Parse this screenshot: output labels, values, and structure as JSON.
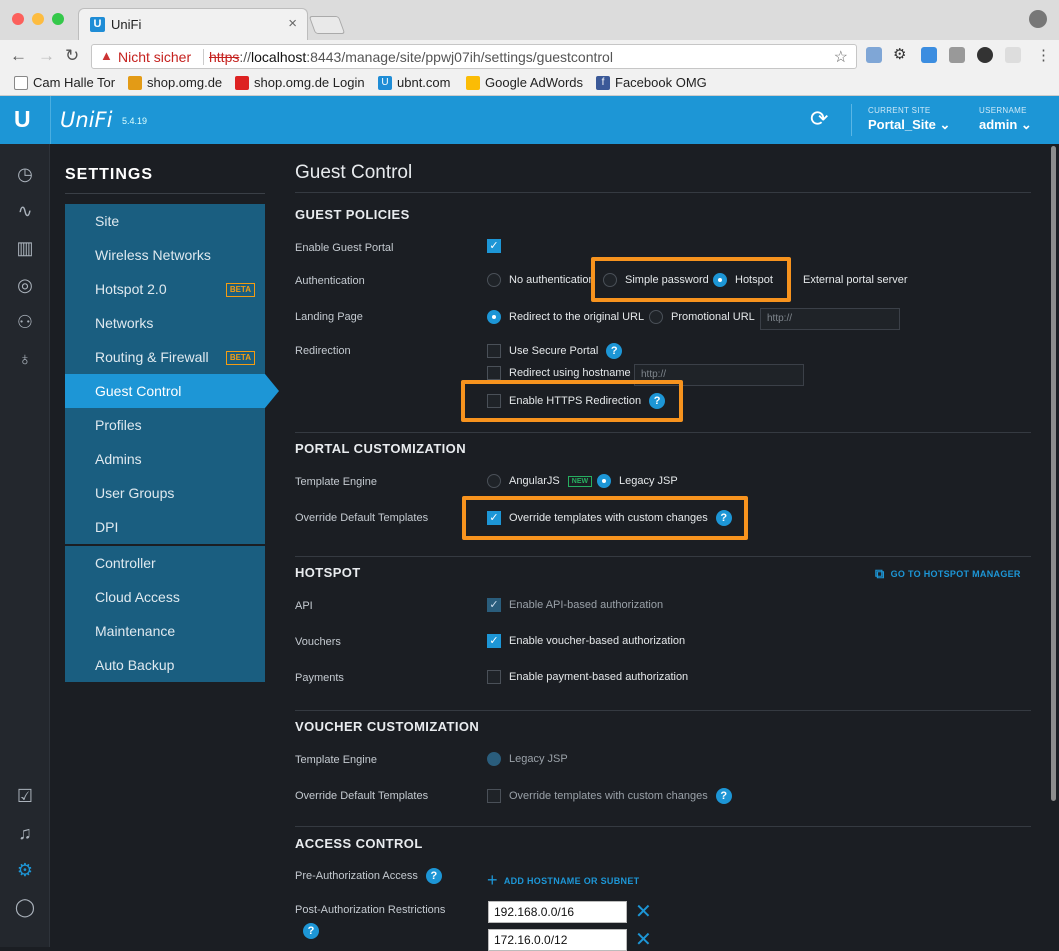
{
  "browser": {
    "tab_title": "UniFi",
    "tab_close": "×",
    "security_label": "Nicht sicher",
    "url_scheme": "https",
    "url_sep": "://",
    "url_host": "localhost",
    "url_rest": ":8443/manage/site/ppwj07ih/settings/guestcontrol",
    "bookmarks": [
      "Cam Halle Tor",
      "shop.omg.de",
      "shop.omg.de Login",
      "ubnt.com",
      "Google AdWords",
      "Facebook OMG"
    ]
  },
  "header": {
    "brand": "UniFi",
    "version": "5.4.19",
    "site_label": "CURRENT SITE",
    "site_value": "Portal_Site",
    "user_label": "USERNAME",
    "user_value": "admin"
  },
  "sidebar": {
    "title": "SETTINGS",
    "items": [
      "Site",
      "Wireless Networks",
      "Hotspot 2.0",
      "Networks",
      "Routing & Firewall",
      "Guest Control",
      "Profiles",
      "Admins",
      "User Groups",
      "DPI"
    ],
    "items2": [
      "Controller",
      "Cloud Access",
      "Maintenance",
      "Auto Backup"
    ],
    "beta": "BETA",
    "active": "Guest Control"
  },
  "page": {
    "title": "Guest Control",
    "guest_policies": {
      "heading": "GUEST POLICIES",
      "enable_portal_label": "Enable Guest Portal",
      "auth_label": "Authentication",
      "auth_options": [
        "No authentication",
        "Simple password",
        "Hotspot",
        "External portal server"
      ],
      "landing_label": "Landing Page",
      "landing_options": [
        "Redirect to the original URL",
        "Promotional URL"
      ],
      "landing_placeholder": "http://",
      "redirection_label": "Redirection",
      "secure_portal": "Use Secure Portal",
      "redirect_hostname": "Redirect using hostname",
      "redirect_placeholder": "http://",
      "https_redirect": "Enable HTTPS Redirection"
    },
    "portal_customization": {
      "heading": "PORTAL CUSTOMIZATION",
      "engine_label": "Template Engine",
      "engine_options": [
        "AngularJS",
        "Legacy JSP"
      ],
      "new_badge": "NEW",
      "override_label": "Override Default Templates",
      "override_option": "Override templates with custom changes"
    },
    "hotspot": {
      "heading": "HOTSPOT",
      "manager_link": "GO TO HOTSPOT MANAGER",
      "api_label": "API",
      "api_option": "Enable API-based authorization",
      "vouchers_label": "Vouchers",
      "vouchers_option": "Enable voucher-based authorization",
      "payments_label": "Payments",
      "payments_option": "Enable payment-based authorization"
    },
    "voucher_customization": {
      "heading": "VOUCHER CUSTOMIZATION",
      "engine_label": "Template Engine",
      "engine_option": "Legacy JSP",
      "override_label": "Override Default Templates",
      "override_option": "Override templates with custom changes"
    },
    "access_control": {
      "heading": "ACCESS CONTROL",
      "pre_auth_label": "Pre-Authorization Access",
      "add_link": "ADD HOSTNAME OR SUBNET",
      "post_auth_label": "Post-Authorization Restrictions",
      "subnets": [
        "192.168.0.0/16",
        "172.16.0.0/12"
      ]
    }
  },
  "colors": {
    "accent": "#1d96d6",
    "highlight": "#f7931e"
  }
}
